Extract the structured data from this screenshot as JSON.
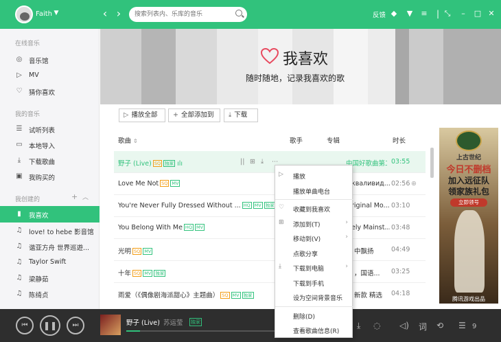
{
  "topbar": {
    "username": "Faith",
    "search_placeholder": "搜索列表内、乐库的音乐",
    "feedback": "反馈"
  },
  "sidebar": {
    "sections": [
      {
        "title": "在线音乐",
        "items": [
          {
            "icon": "music-hall-icon",
            "label": "音乐馆"
          },
          {
            "icon": "mv-icon",
            "label": "MV"
          },
          {
            "icon": "heart-icon",
            "label": "猜你喜欢"
          }
        ]
      },
      {
        "title": "我的音乐",
        "items": [
          {
            "icon": "playlist-icon",
            "label": "试听列表"
          },
          {
            "icon": "monitor-icon",
            "label": "本地导入"
          },
          {
            "icon": "download-icon",
            "label": "下载歌曲"
          },
          {
            "icon": "bag-icon",
            "label": "我购买的"
          }
        ]
      },
      {
        "title": "我创建的",
        "items": [
          {
            "icon": "bars-icon",
            "label": "我喜欢",
            "active": true
          },
          {
            "icon": "note-icon",
            "label": "love! to hebe 影音馆"
          },
          {
            "icon": "note-icon",
            "label": "谐亚方舟 世界巡遊..."
          },
          {
            "icon": "note-icon",
            "label": "Taylor Swift"
          },
          {
            "icon": "note-icon",
            "label": "梁静茹"
          },
          {
            "icon": "note-icon",
            "label": "陈绮贞"
          }
        ]
      }
    ]
  },
  "banner": {
    "title": "我喜欢",
    "subtitle": "随时随地，记录我喜欢的歌"
  },
  "actions": {
    "play_all": "播放全部",
    "add_all": "全部添加到",
    "download": "下载"
  },
  "table": {
    "headers": {
      "song": "歌曲",
      "singer": "歌手",
      "album": "专辑",
      "duration": "时长"
    },
    "rows": [
      {
        "title": "野子 (Live)",
        "tags": [
          "SQ",
          "独家"
        ],
        "album": "中国好歌曲第二...",
        "duration": "03:55"
      },
      {
        "title": "Love Me Not",
        "tags": [
          "SQ",
          "MV"
        ],
        "album": "кваливид...",
        "duration": "02:56"
      },
      {
        "title": "You're Never Fully Dressed Without ...",
        "tags": [
          "HQ",
          "MV",
          "独家"
        ],
        "album": "riginal Mo...",
        "duration": "03:10"
      },
      {
        "title": "You Belong With Me",
        "tags": [
          "HQ",
          "MV"
        ],
        "album": "ely Mainst...",
        "duration": "03:48"
      },
      {
        "title": "光明",
        "tags": [
          "SQ",
          "MV"
        ],
        "album": "中飘扬",
        "duration": "04:49"
      },
      {
        "title": "十年",
        "tags": [
          "SQ",
          "MV",
          "独家"
        ],
        "album": "，国语...",
        "duration": "03:25"
      },
      {
        "title": "雨爱（《偶像剧海派甜心》主题曲）",
        "tags": [
          "SQ",
          "MV",
          "独家"
        ],
        "album": "新款 精选",
        "duration": "04:18"
      }
    ]
  },
  "context_menu": [
    {
      "icon": "play-icon",
      "label": "播放"
    },
    {
      "icon": "",
      "label": "播放单曲电台"
    },
    {
      "sep": true
    },
    {
      "icon": "heart-icon",
      "label": "收藏到我喜欢"
    },
    {
      "icon": "plus-icon",
      "label": "添加到(T)",
      "sub": true
    },
    {
      "icon": "",
      "label": "移动到(V)",
      "sub": true
    },
    {
      "icon": "",
      "label": "点歌分享"
    },
    {
      "icon": "download-icon",
      "label": "下载到电脑",
      "sub": true
    },
    {
      "icon": "",
      "label": "下载到手机"
    },
    {
      "icon": "",
      "label": "设为空间背景音乐"
    },
    {
      "sep": true
    },
    {
      "icon": "",
      "label": "删除(D)"
    },
    {
      "icon": "",
      "label": "查看歌曲信息(R)"
    }
  ],
  "ad": {
    "brand": "上古世纪",
    "line1": "今日不删档",
    "line2": "加入远征队",
    "line3": "领家族礼包",
    "button": "立即领号",
    "footer": "腾讯游戏出品"
  },
  "player": {
    "song": "野子 (Live)",
    "separator": "-",
    "singer": "苏运莹",
    "tag": "独家",
    "count": "9"
  },
  "colors": {
    "brand": "#31c27c"
  }
}
